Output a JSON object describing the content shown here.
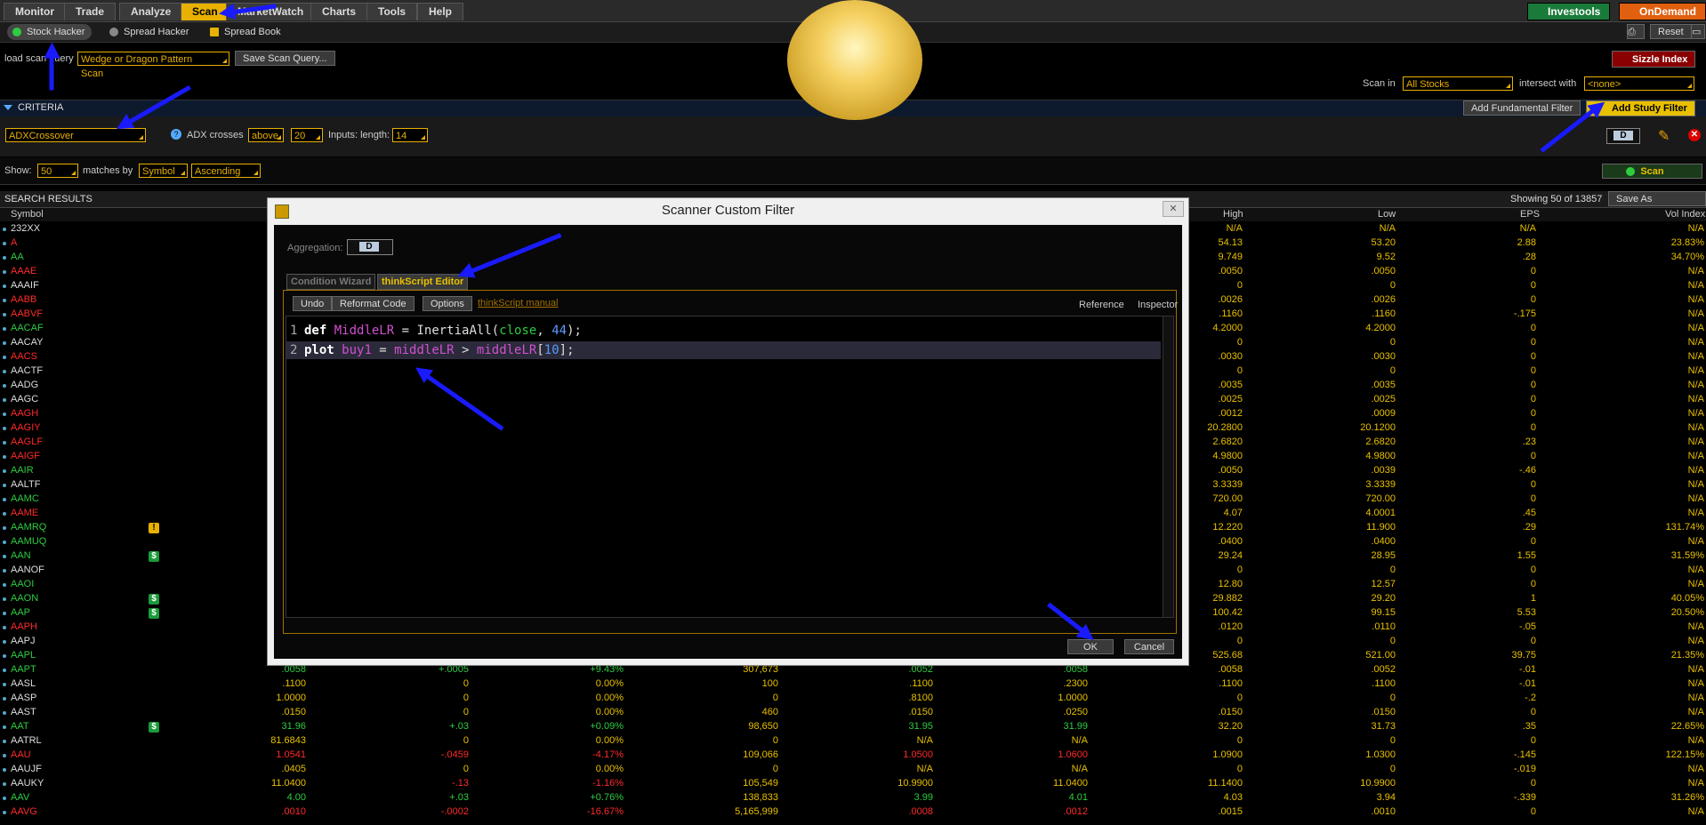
{
  "menu": {
    "tabs": [
      "Monitor",
      "Trade",
      "Analyze",
      "Scan",
      "MarketWatch",
      "Charts",
      "Tools",
      "Help"
    ],
    "active": "Scan",
    "investools": "Investools",
    "ondemand": "OnDemand"
  },
  "subbar": {
    "tabs": [
      "Stock Hacker",
      "Spread Hacker",
      "Spread Book"
    ],
    "reset": "Reset"
  },
  "query": {
    "load_label": "load scan query",
    "query_value": "Wedge or Dragon Pattern Scan",
    "save_button": "Save Scan Query...",
    "sizzle": "Sizzle Index",
    "scan_in_label": "Scan in",
    "scan_in_value": "All Stocks",
    "intersect_label": "intersect with",
    "intersect_value": "<none>"
  },
  "criteria": {
    "title": "CRITERIA",
    "add_fundamental": "Add Fundamental Filter",
    "add_study": "Add Study Filter",
    "study_value": "ADXCrossover",
    "adx_label": "ADX crosses",
    "adx_dir": "above",
    "adx_val": "20",
    "inputs_label": "Inputs: length:",
    "length_val": "14",
    "agg": "D"
  },
  "show": {
    "label": "Show:",
    "value": "50",
    "matches_label": "matches by",
    "sort_by": "Symbol",
    "order": "Ascending",
    "scan_button": "Scan"
  },
  "results": {
    "title": "SEARCH RESULTS",
    "showing": "Showing 50 of 13857",
    "save_watchlist": "Save As Watchlist...",
    "headers": {
      "symbol": "Symbol",
      "high": "High",
      "low": "Low",
      "eps": "EPS",
      "vol": "Vol Index"
    }
  },
  "rows": [
    {
      "sym": "232XX",
      "c": "w",
      "hi": "N/A",
      "lo": "N/A",
      "eps": "N/A",
      "vol": "N/A"
    },
    {
      "sym": "A",
      "c": "r",
      "hi": "54.13",
      "lo": "53.20",
      "eps": "2.88",
      "vol": "23.83%"
    },
    {
      "sym": "AA",
      "c": "g",
      "hi": "9.749",
      "lo": "9.52",
      "eps": ".28",
      "vol": "34.70%"
    },
    {
      "sym": "AAAE",
      "c": "r",
      "hi": ".0050",
      "lo": ".0050",
      "eps": "0",
      "vol": "N/A"
    },
    {
      "sym": "AAAIF",
      "c": "w",
      "hi": "0",
      "lo": "0",
      "eps": "0",
      "vol": "N/A"
    },
    {
      "sym": "AABB",
      "c": "r",
      "hi": ".0026",
      "lo": ".0026",
      "eps": "0",
      "vol": "N/A"
    },
    {
      "sym": "AABVF",
      "c": "r",
      "hi": ".1160",
      "lo": ".1160",
      "eps": "-.175",
      "vol": "N/A"
    },
    {
      "sym": "AACAF",
      "c": "g",
      "hi": "4.2000",
      "lo": "4.2000",
      "eps": "0",
      "vol": "N/A"
    },
    {
      "sym": "AACAY",
      "c": "w",
      "hi": "0",
      "lo": "0",
      "eps": "0",
      "vol": "N/A"
    },
    {
      "sym": "AACS",
      "c": "r",
      "hi": ".0030",
      "lo": ".0030",
      "eps": "0",
      "vol": "N/A"
    },
    {
      "sym": "AACTF",
      "c": "w",
      "hi": "0",
      "lo": "0",
      "eps": "0",
      "vol": "N/A"
    },
    {
      "sym": "AADG",
      "c": "w",
      "hi": ".0035",
      "lo": ".0035",
      "eps": "0",
      "vol": "N/A"
    },
    {
      "sym": "AAGC",
      "c": "w",
      "hi": ".0025",
      "lo": ".0025",
      "eps": "0",
      "vol": "N/A"
    },
    {
      "sym": "AAGH",
      "c": "r",
      "hi": ".0012",
      "lo": ".0009",
      "eps": "0",
      "vol": "N/A"
    },
    {
      "sym": "AAGIY",
      "c": "r",
      "hi": "20.2800",
      "lo": "20.1200",
      "eps": "0",
      "vol": "N/A"
    },
    {
      "sym": "AAGLF",
      "c": "r",
      "hi": "2.6820",
      "lo": "2.6820",
      "eps": ".23",
      "vol": "N/A"
    },
    {
      "sym": "AAIGF",
      "c": "r",
      "hi": "4.9800",
      "lo": "4.9800",
      "eps": "0",
      "vol": "N/A"
    },
    {
      "sym": "AAIR",
      "c": "g",
      "hi": ".0050",
      "lo": ".0039",
      "eps": "-.46",
      "vol": "N/A"
    },
    {
      "sym": "AALTF",
      "c": "w",
      "hi": "3.3339",
      "lo": "3.3339",
      "eps": "0",
      "vol": "N/A"
    },
    {
      "sym": "AAMC",
      "c": "g",
      "hi": "720.00",
      "lo": "720.00",
      "eps": "0",
      "vol": "N/A"
    },
    {
      "sym": "AAME",
      "c": "r",
      "hi": "4.07",
      "lo": "4.0001",
      "eps": ".45",
      "vol": "N/A"
    },
    {
      "sym": "AAMRQ",
      "c": "g",
      "badge": "!",
      "hi": "12.220",
      "lo": "11.900",
      "eps": ".29",
      "vol": "131.74%"
    },
    {
      "sym": "AAMUQ",
      "c": "g",
      "hi": ".0400",
      "lo": ".0400",
      "eps": "0",
      "vol": "N/A"
    },
    {
      "sym": "AAN",
      "c": "g",
      "badge": "$",
      "hi": "29.24",
      "lo": "28.95",
      "eps": "1.55",
      "vol": "31.59%"
    },
    {
      "sym": "AANOF",
      "c": "w",
      "hi": "0",
      "lo": "0",
      "eps": "0",
      "vol": "N/A"
    },
    {
      "sym": "AAOI",
      "c": "g",
      "hi": "12.80",
      "lo": "12.57",
      "eps": "0",
      "vol": "N/A"
    },
    {
      "sym": "AAON",
      "c": "g",
      "badge": "$",
      "hi": "29.882",
      "lo": "29.20",
      "eps": "1",
      "vol": "40.05%"
    },
    {
      "sym": "AAP",
      "c": "g",
      "badge": "$",
      "hi": "100.42",
      "lo": "99.15",
      "eps": "5.53",
      "vol": "20.50%"
    },
    {
      "sym": "AAPH",
      "c": "r",
      "hi": ".0120",
      "lo": ".0110",
      "eps": "-.05",
      "vol": "N/A"
    },
    {
      "sym": "AAPJ",
      "c": "w",
      "hi": "0",
      "lo": "0",
      "eps": "0",
      "vol": "N/A"
    },
    {
      "sym": "AAPL",
      "c": "g",
      "hi": "525.68",
      "lo": "521.00",
      "eps": "39.75",
      "vol": "21.35%"
    },
    {
      "sym": "AAPT",
      "c": "g",
      "last": ".0058",
      "chg": "+.0005",
      "pct": "+9.43%",
      "volm": "307,673",
      "bid": ".0052",
      "ask": ".0058",
      "hi": ".0058",
      "lo": ".0052",
      "eps": "-.01",
      "vol": "N/A"
    },
    {
      "sym": "AASL",
      "c": "w",
      "last": ".1100",
      "chg": "0",
      "pct": "0.00%",
      "volm": "100",
      "bid": ".1100",
      "ask": ".2300",
      "hi": ".1100",
      "lo": ".1100",
      "eps": "-.01",
      "vol": "N/A"
    },
    {
      "sym": "AASP",
      "c": "w",
      "last": "1.0000",
      "chg": "0",
      "pct": "0.00%",
      "volm": "0",
      "bid": ".8100",
      "ask": "1.0000",
      "hi": "0",
      "lo": "0",
      "eps": "-.2",
      "vol": "N/A"
    },
    {
      "sym": "AAST",
      "c": "w",
      "last": ".0150",
      "chg": "0",
      "pct": "0.00%",
      "volm": "460",
      "bid": ".0150",
      "ask": ".0250",
      "hi": ".0150",
      "lo": ".0150",
      "eps": "0",
      "vol": "N/A"
    },
    {
      "sym": "AAT",
      "c": "g",
      "badge": "$",
      "last": "31.96",
      "chg": "+.03",
      "pct": "+0.09%",
      "volm": "98,650",
      "bid": "31.95",
      "ask": "31.99",
      "hi": "32.20",
      "lo": "31.73",
      "eps": ".35",
      "vol": "22.65%"
    },
    {
      "sym": "AATRL",
      "c": "w",
      "last": "81.6843",
      "chg": "0",
      "pct": "0.00%",
      "volm": "0",
      "bid": "N/A",
      "ask": "N/A",
      "hi": "0",
      "lo": "0",
      "eps": "0",
      "vol": "N/A"
    },
    {
      "sym": "AAU",
      "c": "r",
      "last": "1.0541",
      "chg": "-.0459",
      "pct": "-4.17%",
      "volm": "109,066",
      "bid": "1.0500",
      "ask": "1.0600",
      "hi": "1.0900",
      "lo": "1.0300",
      "eps": "-.145",
      "vol": "122.15%"
    },
    {
      "sym": "AAUJF",
      "c": "w",
      "last": ".0405",
      "chg": "0",
      "pct": "0.00%",
      "volm": "0",
      "bid": "N/A",
      "ask": "N/A",
      "hi": "0",
      "lo": "0",
      "eps": "-.019",
      "vol": "N/A"
    },
    {
      "sym": "AAUKY",
      "c": "w",
      "last": "11.0400",
      "chg": "-.13",
      "pct": "-1.16%",
      "volm": "105,549",
      "bid": "10.9900",
      "ask": "11.0400",
      "hi": "11.1400",
      "lo": "10.9900",
      "eps": "0",
      "vol": "N/A"
    },
    {
      "sym": "AAV",
      "c": "g",
      "last": "4.00",
      "chg": "+.03",
      "pct": "+0.76%",
      "volm": "138,833",
      "bid": "3.99",
      "ask": "4.01",
      "hi": "4.03",
      "lo": "3.94",
      "eps": "-.339",
      "vol": "31.26%"
    },
    {
      "sym": "AAVG",
      "c": "r",
      "last": ".0010",
      "chg": "-.0002",
      "pct": "-16.67%",
      "volm": "5,165,999",
      "bid": ".0008",
      "ask": ".0012",
      "hi": ".0015",
      "lo": ".0010",
      "eps": "0",
      "vol": "N/A"
    }
  ],
  "dialog": {
    "title": "Scanner Custom Filter",
    "aggregation_label": "Aggregation:",
    "aggregation_value": "D",
    "tab_wizard": "Condition Wizard",
    "tab_editor": "thinkScript Editor",
    "undo": "Undo",
    "reformat": "Reformat Code",
    "options": "Options",
    "manual": "thinkScript manual",
    "reference": "Reference",
    "inspector": "Inspector",
    "ok": "OK",
    "cancel": "Cancel",
    "line1_no": "1",
    "line2_no": "2"
  },
  "colors": {
    "accent": "#e8b000",
    "up": "#2ecc40",
    "down": "#ff2a2a",
    "arrow": "#1a1aff"
  }
}
